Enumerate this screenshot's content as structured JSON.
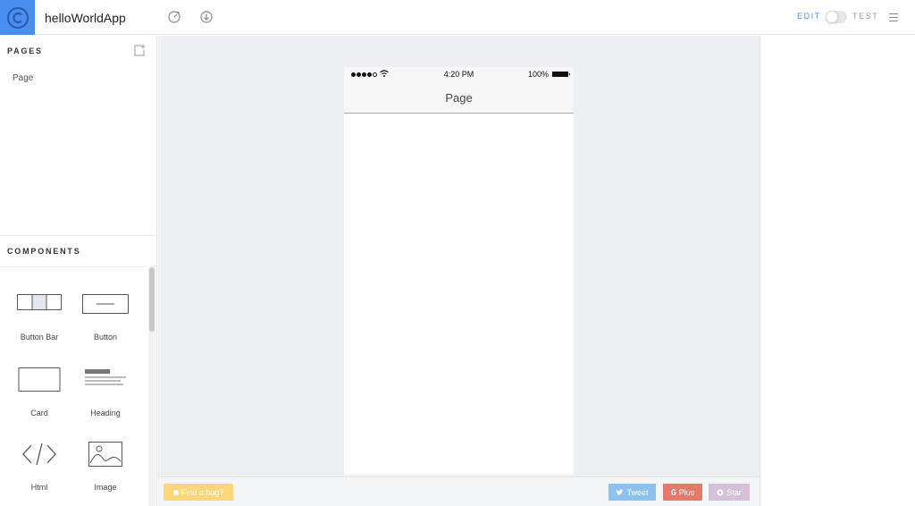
{
  "app": {
    "title": "helloWorldApp"
  },
  "topbar": {
    "mode_edit": "EDIT",
    "mode_test": "TEST"
  },
  "sidebar": {
    "pages_title": "PAGES",
    "pages": [
      {
        "label": "Page"
      }
    ],
    "components_title": "COMPONENTS",
    "components": [
      {
        "label": "Button Bar",
        "icon": "button-bar-icon"
      },
      {
        "label": "Button",
        "icon": "button-icon"
      },
      {
        "label": "Card",
        "icon": "card-icon"
      },
      {
        "label": "Heading",
        "icon": "heading-icon"
      },
      {
        "label": "Html",
        "icon": "code-icon"
      },
      {
        "label": "Image",
        "icon": "image-icon"
      }
    ]
  },
  "phone": {
    "time": "4:20 PM",
    "battery": "100%",
    "nav_title": "Page"
  },
  "bottombar": {
    "bug_label": "Find a bug?",
    "tweet_label": "Tweet",
    "plus_label": "Plus",
    "star_label": "Star"
  },
  "colors": {
    "accent": "#4a8ef0",
    "canvas_bg": "#eeeff3",
    "bug": "#fbd77a",
    "tweet": "#8dc2ee",
    "plus": "#e7796b",
    "star": "#d6c0d9"
  }
}
